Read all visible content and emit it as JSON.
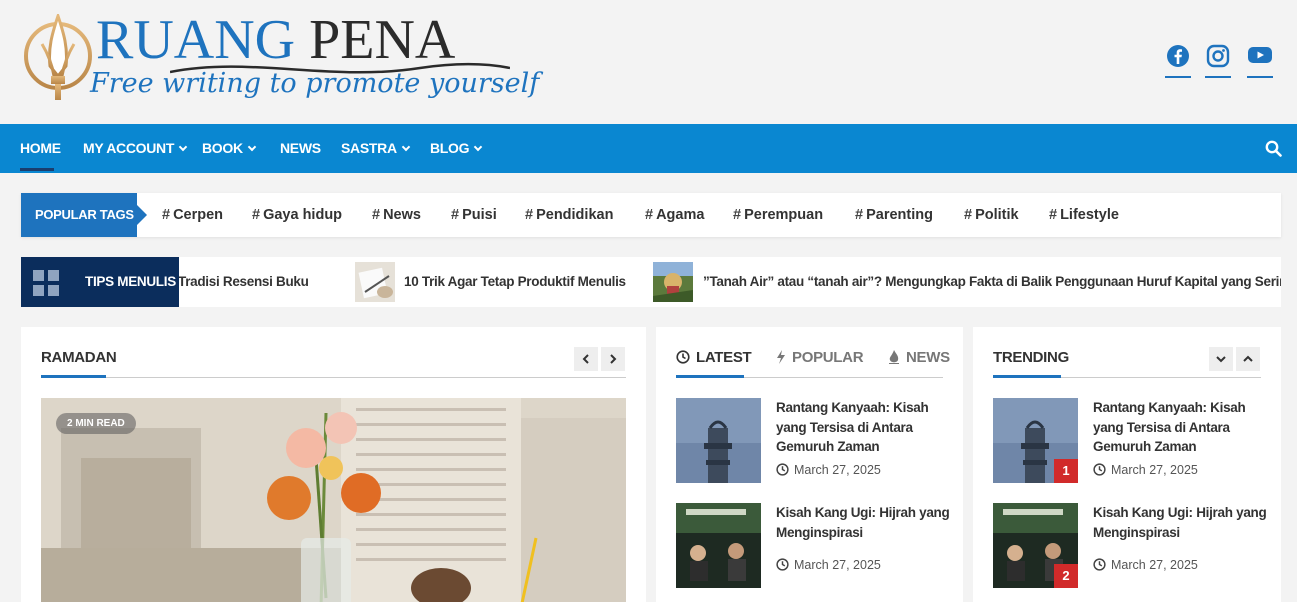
{
  "brand": {
    "title_part1": "RUANG",
    "title_part2": "PENA",
    "tagline": "Free writing to promote yourself",
    "accent_color": "#1e73be",
    "nav_color": "#0a87d1"
  },
  "social": {
    "icons": [
      "facebook-icon",
      "instagram-icon",
      "youtube-icon"
    ]
  },
  "nav": {
    "items": [
      {
        "label": "HOME"
      },
      {
        "label": "MY ACCOUNT"
      },
      {
        "label": "BOOK"
      },
      {
        "label": "NEWS"
      },
      {
        "label": "SASTRA"
      },
      {
        "label": "BLOG"
      }
    ]
  },
  "tags": {
    "label": "POPULAR TAGS",
    "items": [
      "Cerpen",
      "Gaya hidup",
      "News",
      "Puisi",
      "Pendidikan",
      "Agama",
      "Perempuan",
      "Parenting",
      "Politik",
      "Lifestyle"
    ]
  },
  "ticker": {
    "label": "TIPS MENULIS",
    "items": [
      "Tradisi Resensi Buku",
      "10 Trik Agar Tetap Produktif Menulis",
      "”Tanah Air” atau “tanah air”? Mengungkap Fakta di Balik Penggunaan Huruf Kapital yang Sering K"
    ]
  },
  "ramadan": {
    "title": "RAMADAN",
    "badge": "2 MIN READ"
  },
  "tabs": {
    "items": [
      "LATEST",
      "POPULAR",
      "NEWS"
    ]
  },
  "latest": {
    "posts": [
      {
        "title": "Rantang Kanyaah: Kisah yang Tersisa di Antara Gemuruh Zaman",
        "date": "March 27, 2025"
      },
      {
        "title": "Kisah Kang Ugi: Hijrah yang Menginspirasi",
        "date": "March 27, 2025"
      }
    ]
  },
  "trending": {
    "title": "TRENDING",
    "posts": [
      {
        "title": "Rantang Kanyaah: Kisah yang Tersisa di Antara Gemuruh Zaman",
        "date": "March 27, 2025",
        "rank": "1"
      },
      {
        "title": "Kisah Kang Ugi: Hijrah yang Menginspirasi",
        "date": "March 27, 2025",
        "rank": "2"
      }
    ]
  }
}
